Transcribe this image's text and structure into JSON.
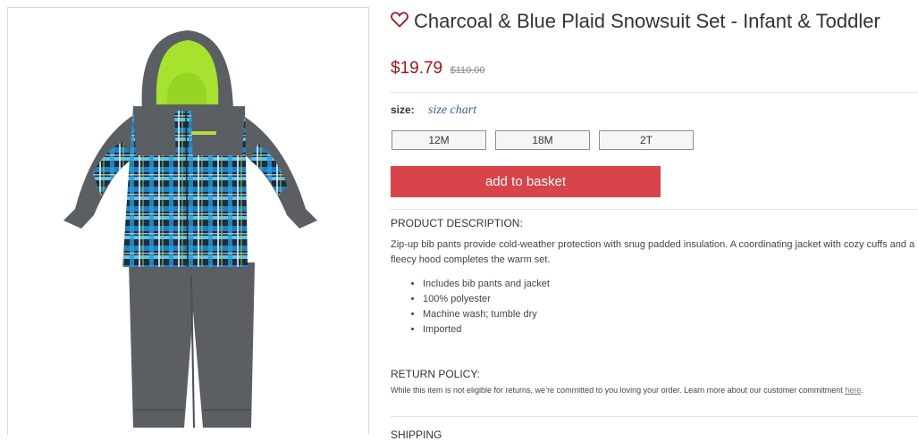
{
  "product": {
    "title": "Charcoal & Blue Plaid Snowsuit Set - Infant & Toddler",
    "price": "$19.79",
    "original_price": "$110.00",
    "accent_color": "#a5161c",
    "heart_icon": "heart-outline-icon"
  },
  "size": {
    "label": "size:",
    "chart_link": "size chart",
    "options": [
      "12M",
      "18M",
      "2T"
    ]
  },
  "actions": {
    "add_to_basket": "add to basket",
    "button_color": "#d9434a"
  },
  "description": {
    "heading": "PRODUCT DESCRIPTION:",
    "text": "Zip-up bib pants provide cold-weather protection with snug padded insulation. A coordinating jacket with cozy cuffs and a fleecy hood completes the warm set.",
    "bullets": [
      "Includes bib pants and jacket",
      "100% polyester",
      "Machine wash; tumble dry",
      "Imported"
    ]
  },
  "return_policy": {
    "heading": "RETURN POLICY:",
    "text": "While this item is not eligible for returns, we’re committed to you loving your order. Learn more about our customer commitment ",
    "link": "here",
    "suffix": "."
  },
  "shipping": {
    "heading": "SHIPPING"
  }
}
